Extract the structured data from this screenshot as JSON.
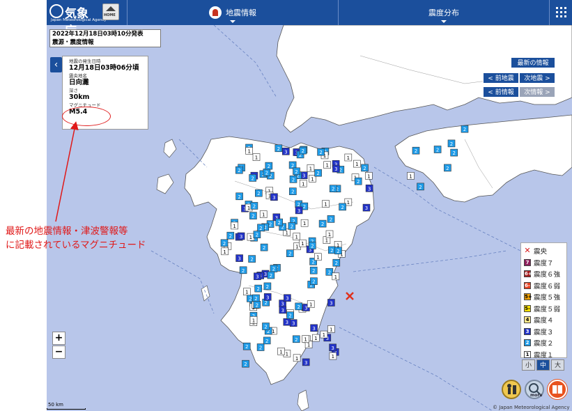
{
  "header": {
    "logo_name": "気象庁",
    "logo_en": "Japan Meteorological Agency",
    "home_label": "HOME",
    "tab_quake": "地震情報",
    "tab_intensity": "震度分布"
  },
  "report": {
    "issued": "2022年12月18日03時10分発表",
    "type": "震源・震度情報"
  },
  "info": {
    "time_label": "地震の発生日時",
    "time_value": "12月18日03時06分頃",
    "place_label": "震央地名",
    "place_value": "日向灘",
    "depth_label": "深さ",
    "depth_value": "30km",
    "mag_label": "マグニチュード",
    "mag_value": "M5.4"
  },
  "nav": {
    "latest": "最新の情報",
    "prev_quake": "< 前地震",
    "next_quake": "次地震 >",
    "prev_info": "< 前情報",
    "next_info": "次情報 >"
  },
  "legend": {
    "epicenter": "震央",
    "items": [
      {
        "label": "震度７",
        "mark": "7",
        "color": "#8e1f5c",
        "text": "#fff"
      },
      {
        "label": "震度６強",
        "mark": "6+",
        "color": "#a51d1d",
        "text": "#fff"
      },
      {
        "label": "震度６弱",
        "mark": "6-",
        "color": "#e8401f",
        "text": "#fff"
      },
      {
        "label": "震度５強",
        "mark": "5+",
        "color": "#f0a000",
        "text": "#000"
      },
      {
        "label": "震度５弱",
        "mark": "5-",
        "color": "#ffe400",
        "text": "#000"
      },
      {
        "label": "震度４",
        "mark": "4",
        "color": "#ffe98a",
        "text": "#000"
      },
      {
        "label": "震度３",
        "mark": "3",
        "color": "#2233c8",
        "text": "#fff"
      },
      {
        "label": "震度２",
        "mark": "2",
        "color": "#1e9be8",
        "text": "#fff"
      },
      {
        "label": "震度１",
        "mark": "1",
        "color": "#ffffff",
        "text": "#000"
      }
    ]
  },
  "size_buttons": [
    "小",
    "中",
    "大"
  ],
  "zoom": {
    "in": "+",
    "out": "−"
  },
  "scale_text": "50 km",
  "copyright": "© Japan Meteorological Agency",
  "button_more": "more",
  "annotation": {
    "line1": "最新の地震情報・津波警報等",
    "line2": "に記載されているマグニチュード"
  },
  "colors": {
    "header": "#1b4f9c",
    "sea": "#b8c6ea",
    "land": "#ffffff",
    "annotation": "#e01818"
  }
}
